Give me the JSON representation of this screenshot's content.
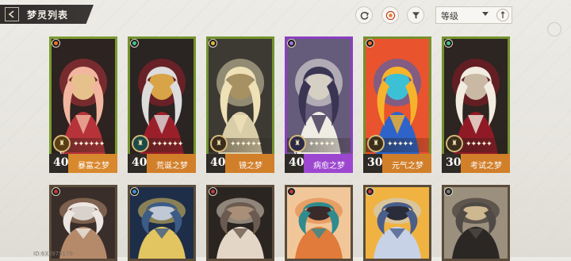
{
  "header": {
    "title": "梦灵列表"
  },
  "toolbar": {
    "sort_label": "等级"
  },
  "colors": {
    "accent_orange": "#e8822a",
    "frame_green": "#6d8a2b",
    "frame_purple": "#8a3fc0"
  },
  "cards_top": [
    {
      "level": "40",
      "name": "暴富之梦",
      "rank": "V",
      "stars": "✦✦✦✦✦✦",
      "frame": "#7a9b2f",
      "footer": "#d8882d",
      "badge": "#5a3d14",
      "elem": "#e9742b",
      "art": [
        "#f2b6a0",
        "#b6333a",
        "#2d2320",
        "#e7c18c"
      ]
    },
    {
      "level": "40",
      "name": "荒诞之梦",
      "rank": "",
      "stars": "✦✦✦✦✦✦",
      "frame": "#73922d",
      "footer": "#d27f2a",
      "badge": "#1d4a48",
      "elem": "#46c18c",
      "art": [
        "#dcdcdc",
        "#9b1f2a",
        "#2a2422",
        "#d8a447"
      ]
    },
    {
      "level": "40",
      "name": "镜之梦",
      "rank": "",
      "stars": "✦✦✦✦✦✦",
      "frame": "#73922d",
      "footer": "#d27f2a",
      "badge": "#3b2e1c",
      "elem": "#e8b43c",
      "art": [
        "#efe1b6",
        "#d9cda8",
        "#3d3a34",
        "#a79162"
      ]
    },
    {
      "level": "40",
      "name": "病愈之梦",
      "rank": "VI",
      "stars": "✦✦✦✦✦",
      "frame": "#8a3fc0",
      "footer": "#9d47d0",
      "badge": "#2d2a46",
      "elem": "#a070e0",
      "art": [
        "#3b3554",
        "#efece4",
        "#655b7a",
        "#d5cfc4"
      ]
    },
    {
      "level": "30",
      "name": "元气之梦",
      "rank": "",
      "stars": "✦✦✦✦✦",
      "frame": "#73922d",
      "footer": "#d27f2a",
      "badge": "#3b2e1c",
      "elem": "#e9742b",
      "art": [
        "#f7b32b",
        "#2e64c9",
        "#e9532e",
        "#3bc0d6"
      ]
    },
    {
      "level": "30",
      "name": "考试之梦",
      "rank": "",
      "stars": "✦✦✦✦✦",
      "frame": "#73922d",
      "footer": "#d27f2a",
      "badge": "#3b2e1c",
      "elem": "#46c18c",
      "art": [
        "#f1ebe0",
        "#8f1a25",
        "#2c2521",
        "#c9b9a4"
      ]
    }
  ],
  "cards_bottom": [
    {
      "frame": "#5a4b3a",
      "elem": "#c33a3a",
      "art": [
        "#ece6e2",
        "#b58a6a",
        "#3a2e2a",
        "#d9d2cc"
      ]
    },
    {
      "frame": "#5a4b3a",
      "elem": "#3a8fd8",
      "art": [
        "#3c5b86",
        "#e2c560",
        "#1e2e48",
        "#bfc8d4"
      ]
    },
    {
      "frame": "#5a4b3a",
      "elem": "#c33a3a",
      "art": [
        "#6b5a4f",
        "#e4d6c6",
        "#2b2521",
        "#a98f78"
      ]
    },
    {
      "frame": "#5a4b3a",
      "elem": "#c33a3a",
      "art": [
        "#2f8b8d",
        "#e07b3b",
        "#f1c79a",
        "#3a2a2a"
      ]
    },
    {
      "frame": "#5a4b3a",
      "elem": "#c33a3a",
      "art": [
        "#4a5e8a",
        "#c8d2e6",
        "#f0b341",
        "#2a2c3a"
      ]
    },
    {
      "frame": "#5a4b3a",
      "elem": "#7a7a7a",
      "art": [
        "#4f4a45",
        "#2b2724",
        "#9b8f7e",
        "#cdb88f"
      ]
    }
  ],
  "footer_text": {
    "id": "ID:632975179"
  }
}
